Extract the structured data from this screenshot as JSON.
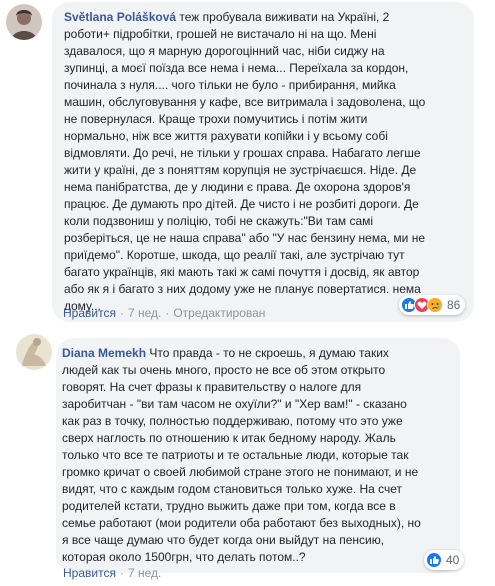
{
  "comments": [
    {
      "author": "Světlana Polášková",
      "text": "теж пробувала виживати на Україні, 2\nроботи+ підробітки, грошей не вистачало ні на що. Мені\nздавалося, що я марную дорогоцінний час, ніби сиджу на\nзупинці, а моєї поїзда все нема і нема... Переїхала за кордон,\nпочинала з нуля.... чого тільки не було - прибирання, мийка\nмашин, обслуговування у кафе, все витримала і задоволена, що\nне повернулася. Краще трохи помучитись і потім жити\nнормально, ніж все життя рахувати копійки і у всьому собі\nвідмовляти. До речі, не тільки у грошах справа. Набагато легше\nжити у країні, де з поняттям корупція не зустрічаєшся. Ніде. Де\nнема панібратства, де у людини є права. Де охорона здоров'я\nпрацює. Де думають про дітей. Де чисто і не розбиті дороги. Де\nколи подзвониш у поліцію, тобі не скажуть:\"Ви там самі\nрозберіться, це не наша справа\" або \"У нас бензину нема, ми не\nприїдемо\". Коротше, шкода, що реалії такі, але зустрічаю тут\nбагато українців, які мають такі ж самі почуття і досвід, як автор\nабо як я і багато з них додому уже не планує повертатися. нема\nдому...",
      "reaction_count": "86",
      "reactions": [
        "like-icon",
        "love-icon",
        "sad-icon"
      ],
      "actions": {
        "like": "Нравится",
        "time": "7 нед.",
        "edited": "Отредактирован"
      }
    },
    {
      "author": "Diana Memekh",
      "text": "Что правда - то не скроешь, я думаю таких\nлюдей как ты очень много, просто не все об этом открыто\nговорят. На счет фразы к правительству о налоге для\nзаробитчан - \"ви там часом не охуїли?\" и \"Хер вам!\" - сказано\nкак раз в точку, полностью поддерживаю, потому что это уже\nсверх наглость по отношению к итак бедному народу. Жаль\nтолько что все те патриоты и те остальные люди, которые так\nгромко кричат о своей любимой стране этого не понимают, и не\nвидят, что с каждым годом становиться только хуже. На счет\nродителей кстати, трудно выжить даже при том, когда все в\nсемье работают (мои родители оба работают без выходных), но\nя все чаще думаю что будет когда они выйдут на пенсию,\nкоторая около 1500грн, что делать потом..?",
      "reaction_count": "40",
      "reactions": [
        "like-icon"
      ],
      "actions": {
        "like": "Нравится",
        "time": "7 нед."
      }
    }
  ],
  "colors": {
    "link": "#385898",
    "bubble": "#f2f3f5",
    "meta": "#90949c",
    "like": "#1877f2",
    "love": "#f33e58",
    "sad": "#f7b125"
  }
}
